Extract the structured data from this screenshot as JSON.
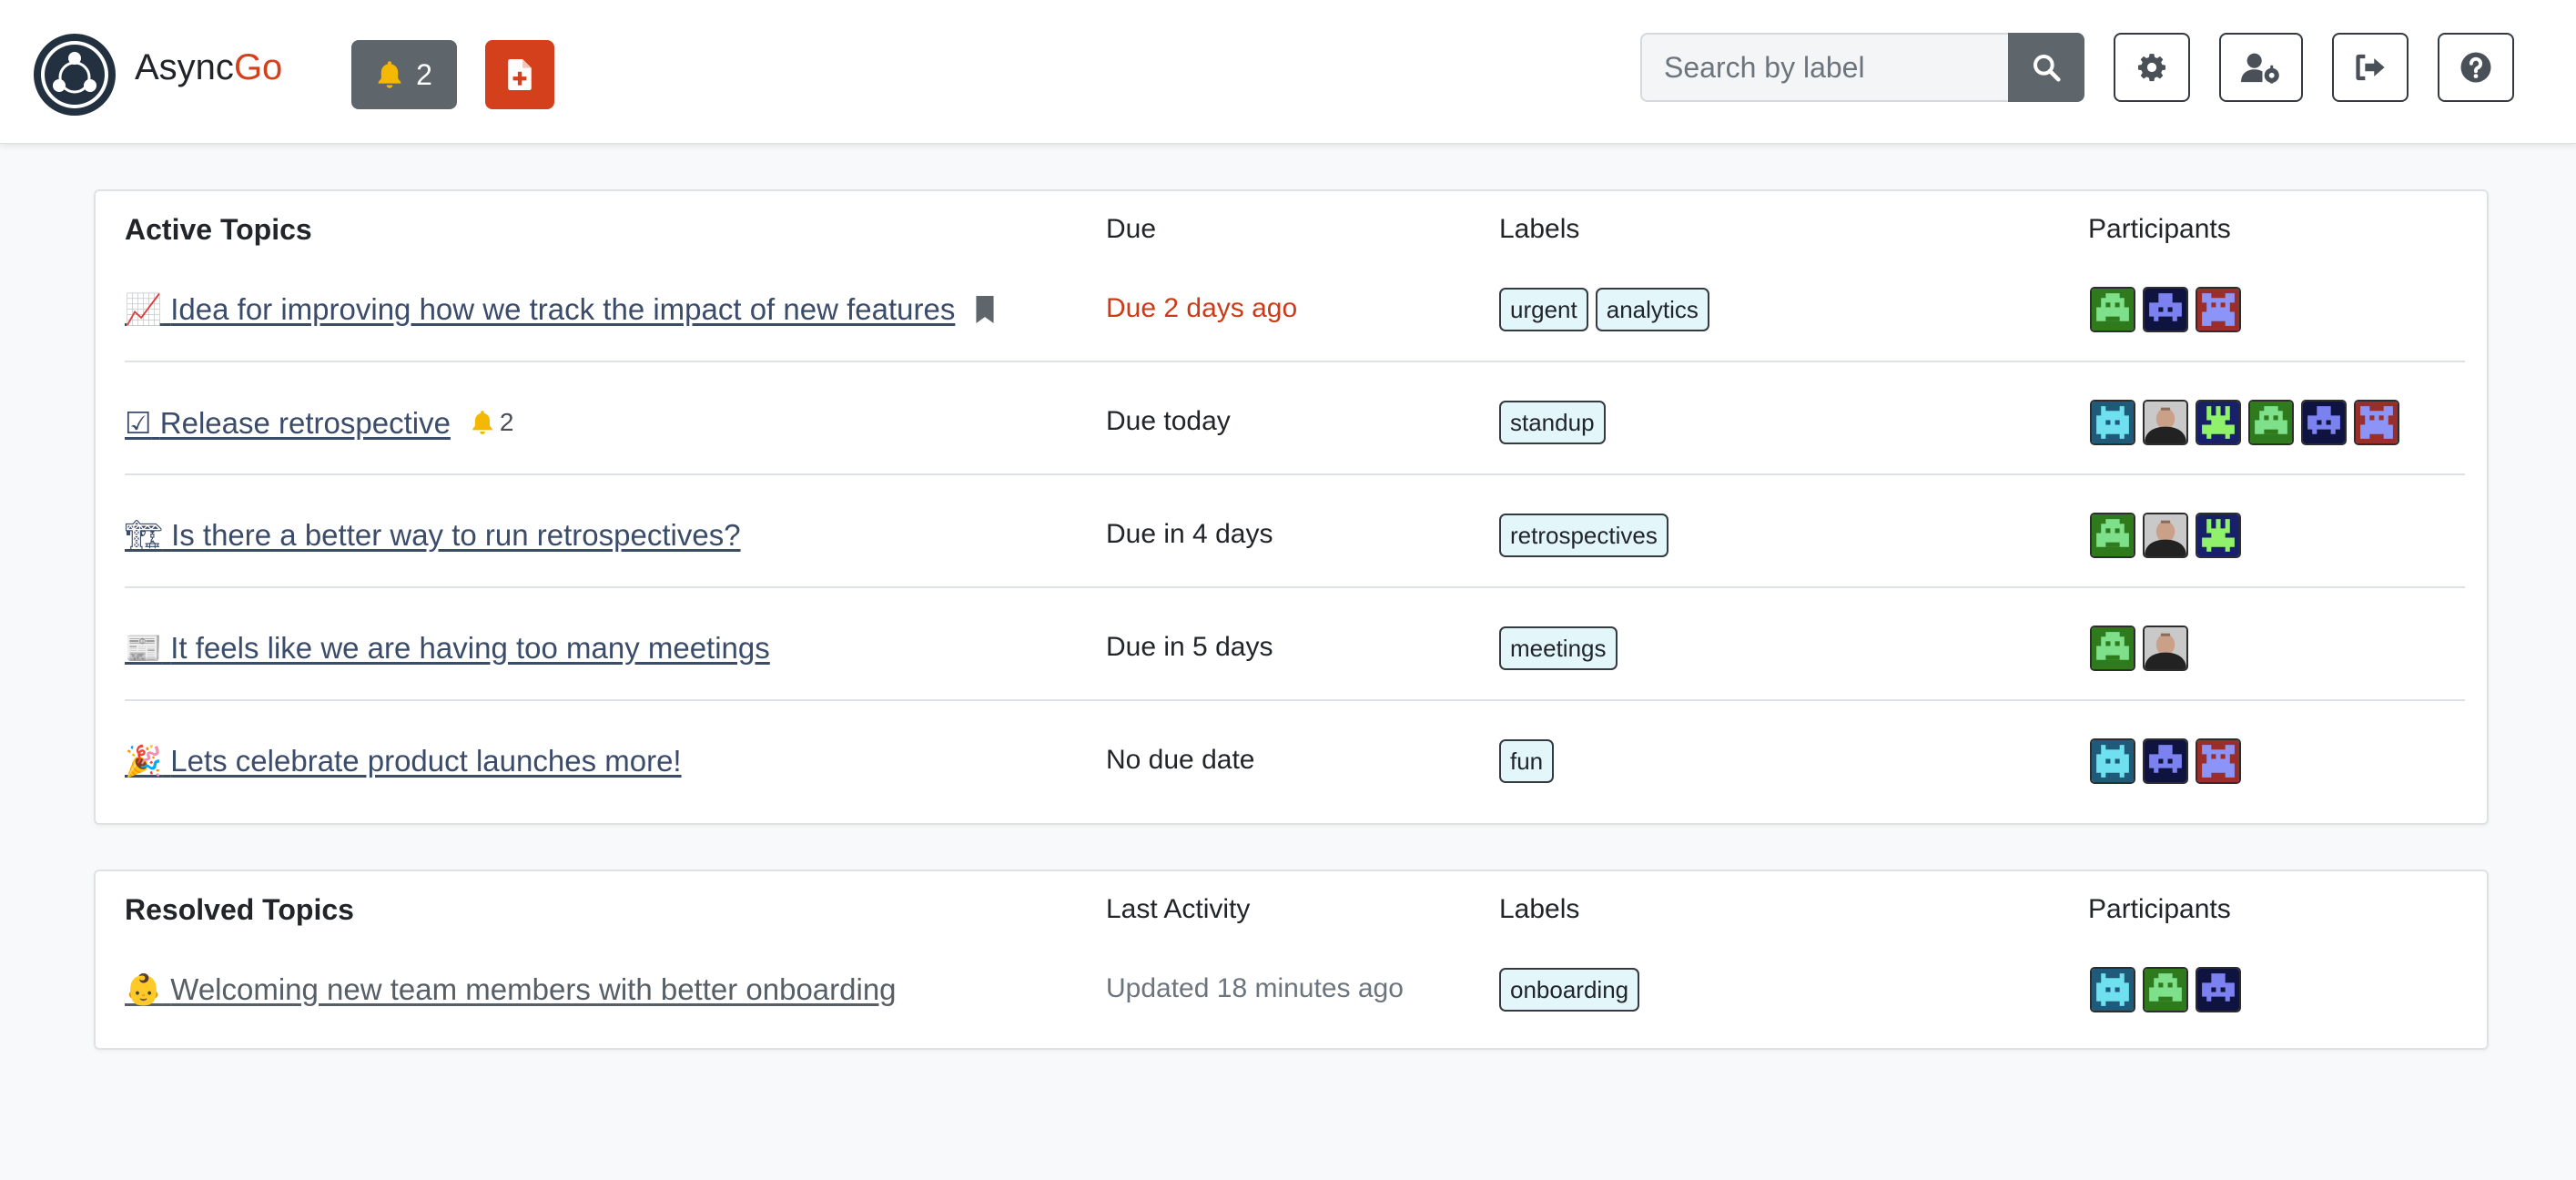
{
  "brand": {
    "name_prefix": "Async",
    "name_suffix": "Go"
  },
  "header": {
    "notification_count": "2",
    "search_placeholder": "Search by label"
  },
  "colors": {
    "accent": "#d4401c",
    "dark_button": "#5e656b",
    "label_bg": "#e3f7fb",
    "link": "#3b4c6b"
  },
  "icons": {
    "logo": "asyncgo-logo",
    "bell": "bell-icon",
    "new_document": "file-plus-icon",
    "search": "search-icon",
    "settings": "gear-icon",
    "user_settings": "user-gear-icon",
    "logout": "sign-out-icon",
    "help": "question-circle-icon",
    "bookmark": "bookmark-icon"
  },
  "active": {
    "title": "Active Topics",
    "due_header": "Due",
    "labels_header": "Labels",
    "participants_header": "Participants",
    "topics": [
      {
        "emoji": "📈",
        "title": "Idea for improving how we track the impact of new features",
        "bookmarked": true,
        "due": "Due 2 days ago",
        "labels": [
          "urgent",
          "analytics"
        ],
        "participants": [
          "green",
          "navy",
          "red"
        ]
      },
      {
        "emoji": "☑",
        "title": "Release retrospective",
        "notifications": "2",
        "due": "Due today",
        "labels": [
          "standup"
        ],
        "participants": [
          "cyan",
          "photo",
          "olive",
          "green",
          "navy",
          "red"
        ]
      },
      {
        "emoji": "🏗",
        "title": "Is there a better way to run retrospectives?",
        "due": "Due in 4 days",
        "labels": [
          "retrospectives"
        ],
        "participants": [
          "green",
          "photo",
          "olive"
        ]
      },
      {
        "emoji": "📰",
        "title": "It feels like we are having too many meetings",
        "due": "Due in 5 days",
        "labels": [
          "meetings"
        ],
        "participants": [
          "green",
          "photo"
        ]
      },
      {
        "emoji": "🎉",
        "title": "Lets celebrate product launches more!",
        "due": "No due date",
        "labels": [
          "fun"
        ],
        "participants": [
          "cyan",
          "navy",
          "red"
        ]
      }
    ]
  },
  "resolved": {
    "title": "Resolved Topics",
    "activity_header": "Last Activity",
    "labels_header": "Labels",
    "participants_header": "Participants",
    "topics": [
      {
        "emoji": "👶",
        "title": "Welcoming new team members with better onboarding",
        "activity": "Updated 18 minutes ago",
        "labels": [
          "onboarding"
        ],
        "participants": [
          "cyan",
          "green",
          "navy"
        ]
      }
    ]
  }
}
